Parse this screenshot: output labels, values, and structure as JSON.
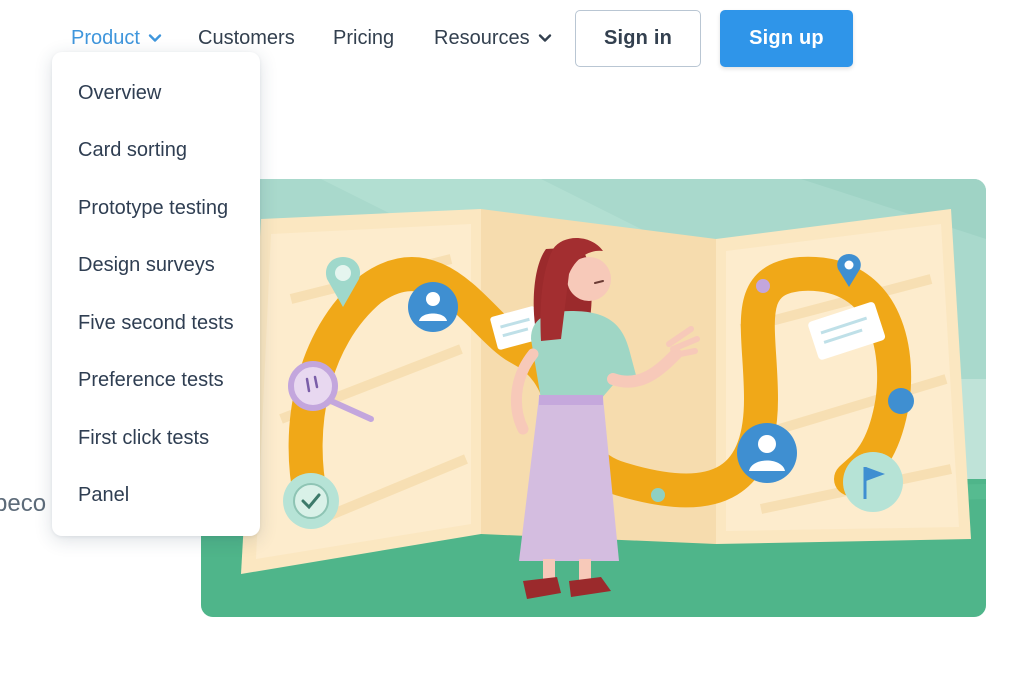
{
  "nav": {
    "product": "Product",
    "customers": "Customers",
    "pricing": "Pricing",
    "resources": "Resources",
    "sign_in": "Sign in",
    "sign_up": "Sign up"
  },
  "dropdown": {
    "items": [
      "Overview",
      "Card sorting",
      "Prototype testing",
      "Design surveys",
      "Five second tests",
      "Preference tests",
      "First click tests",
      "Panel"
    ]
  },
  "background": {
    "partial_text": "peco"
  },
  "colors": {
    "accent": "#3f96dc",
    "signup_bg": "#2f95e9",
    "ground_green": "#4fb58a",
    "path_orange": "#f0a818"
  }
}
